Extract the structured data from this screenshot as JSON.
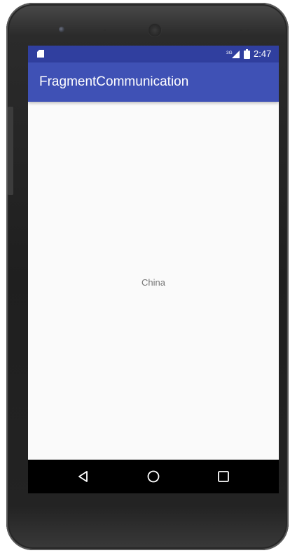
{
  "status_bar": {
    "time": "2:47",
    "network_type": "3G",
    "color": "#303f9f",
    "icons": [
      "sd-card-icon",
      "signal-icon",
      "battery-icon"
    ]
  },
  "app_bar": {
    "title": "FragmentCommunication",
    "color": "#3f51b5"
  },
  "content": {
    "text": "China"
  },
  "nav_bar": {
    "buttons": [
      "back-icon",
      "home-icon",
      "recents-icon"
    ]
  }
}
